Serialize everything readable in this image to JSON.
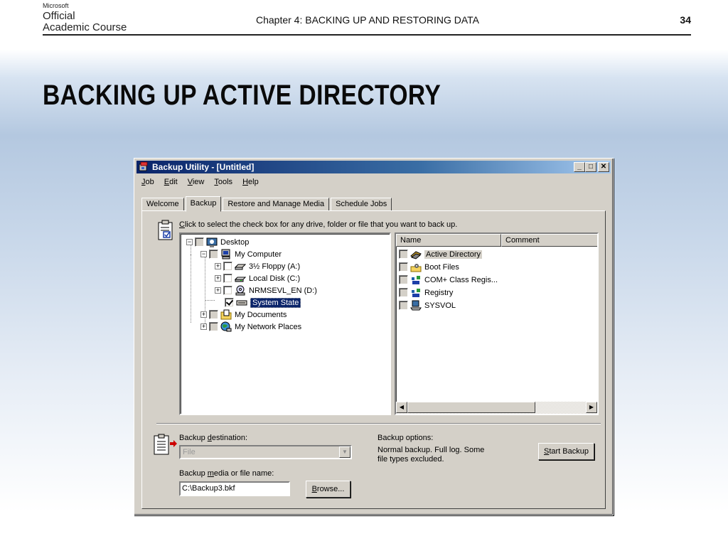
{
  "slide": {
    "logo": {
      "line1": "Microsoft",
      "line2": "Official",
      "line3": "Academic Course"
    },
    "chapter": "Chapter 4: BACKING UP AND RESTORING DATA",
    "page_number": "34",
    "title": "BACKING UP ACTIVE DIRECTORY"
  },
  "window": {
    "title": "Backup Utility - [Untitled]",
    "controls": {
      "minimize": "_",
      "maximize": "□",
      "close": "✕"
    },
    "menu": [
      {
        "key": "J",
        "rest": "ob"
      },
      {
        "key": "E",
        "rest": "dit"
      },
      {
        "key": "V",
        "rest": "iew"
      },
      {
        "key": "T",
        "rest": "ools"
      },
      {
        "key": "H",
        "rest": "elp"
      }
    ],
    "tabs": [
      "Welcome",
      "Backup",
      "Restore and Manage Media",
      "Schedule Jobs"
    ],
    "active_tab": "Backup"
  },
  "backup": {
    "instruction_key": "C",
    "instruction_rest": "lick to select the check box for any drive, folder or file that you want to back up.",
    "tree": [
      {
        "label": "Desktop",
        "expander": "−",
        "icon": "desktop-icon"
      },
      {
        "label": "My Computer",
        "expander": "−",
        "icon": "computer-icon"
      },
      {
        "label": "3½ Floppy (A:)",
        "expander": "+",
        "icon": "floppy-drive-icon"
      },
      {
        "label": "Local Disk (C:)",
        "expander": "+",
        "icon": "hard-disk-icon"
      },
      {
        "label": "NRMSEVL_EN (D:)",
        "expander": "+",
        "icon": "cd-drive-icon"
      },
      {
        "label": "System State",
        "expander": "",
        "icon": "system-state-icon",
        "checked": true,
        "selected": true
      },
      {
        "label": "My Documents",
        "expander": "+",
        "icon": "folder-icon"
      },
      {
        "label": "My Network Places",
        "expander": "+",
        "icon": "network-places-icon"
      }
    ],
    "list_columns": [
      "Name",
      "Comment"
    ],
    "list_items": [
      {
        "label": "Active Directory",
        "icon": "active-directory-icon"
      },
      {
        "label": "Boot Files",
        "icon": "boot-files-icon"
      },
      {
        "label": "COM+ Class Regis...",
        "icon": "com-plus-icon"
      },
      {
        "label": "Registry",
        "icon": "registry-icon"
      },
      {
        "label": "SYSVOL",
        "icon": "sysvol-icon"
      }
    ],
    "scroll": {
      "left": "◀",
      "right": "▶"
    },
    "destination_label_pre": "Backup ",
    "destination_label_key": "d",
    "destination_label_post": "estination:",
    "destination_value": "File",
    "combo_arrow": "▼",
    "media_label_pre": "Backup ",
    "media_label_key": "m",
    "media_label_post": "edia or file name:",
    "media_value": "C:\\Backup3.bkf",
    "browse_key": "B",
    "browse_rest": "rowse...",
    "options_label": "Backup options:",
    "options_line1": "Normal backup.  Full log.  Some",
    "options_line2": "file types excluded.",
    "start_key": "S",
    "start_rest": "tart Backup"
  }
}
